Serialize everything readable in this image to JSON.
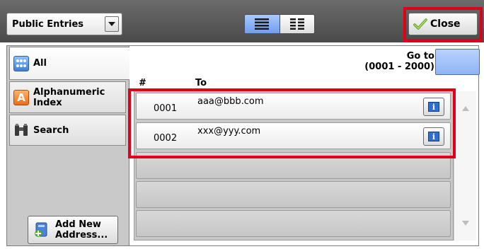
{
  "header": {
    "dropdown_label": "Public Entries",
    "close_label": "Close"
  },
  "tabs": [
    {
      "label": "All",
      "icon": "address-book-icon",
      "selected": true
    },
    {
      "label": "Alphanumeric\nIndex",
      "icon": "letter-a-icon",
      "selected": false
    },
    {
      "label": "Search",
      "icon": "binoculars-icon",
      "selected": false
    }
  ],
  "add_new_label": "Add New\nAddress...",
  "goto": {
    "label": "Go to",
    "range": "(0001 - 2000)"
  },
  "columns": {
    "hash": "#",
    "to": "To"
  },
  "entries": [
    {
      "number": "0001",
      "address": "aaa@bbb.com"
    },
    {
      "number": "0002",
      "address": "xxx@yyy.com"
    }
  ],
  "colors": {
    "highlight": "#e0001a",
    "accent_blue": "#8fb4f4"
  }
}
